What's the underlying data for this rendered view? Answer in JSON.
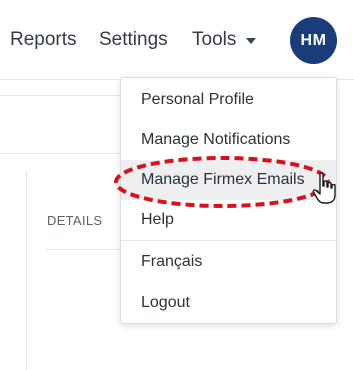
{
  "header": {
    "nav": [
      {
        "label": "Reports"
      },
      {
        "label": "Settings"
      },
      {
        "label": "Tools"
      }
    ],
    "avatar_initials": "HM"
  },
  "content": {
    "details_label": "DETAILS"
  },
  "dropdown": {
    "items": [
      {
        "label": "Personal Profile"
      },
      {
        "label": "Manage Notifications"
      },
      {
        "label": "Manage Firmex Emails"
      },
      {
        "label": "Help"
      },
      {
        "label": "Français"
      },
      {
        "label": "Logout"
      }
    ],
    "hovered_item": "Manage Firmex Emails"
  },
  "colors": {
    "avatar_bg": "#183d7a",
    "annotation_red": "#d8121d",
    "hover_bg": "#eeeff1"
  },
  "icons": [
    "chevron-down-icon",
    "hand-pointer-cursor-icon"
  ]
}
